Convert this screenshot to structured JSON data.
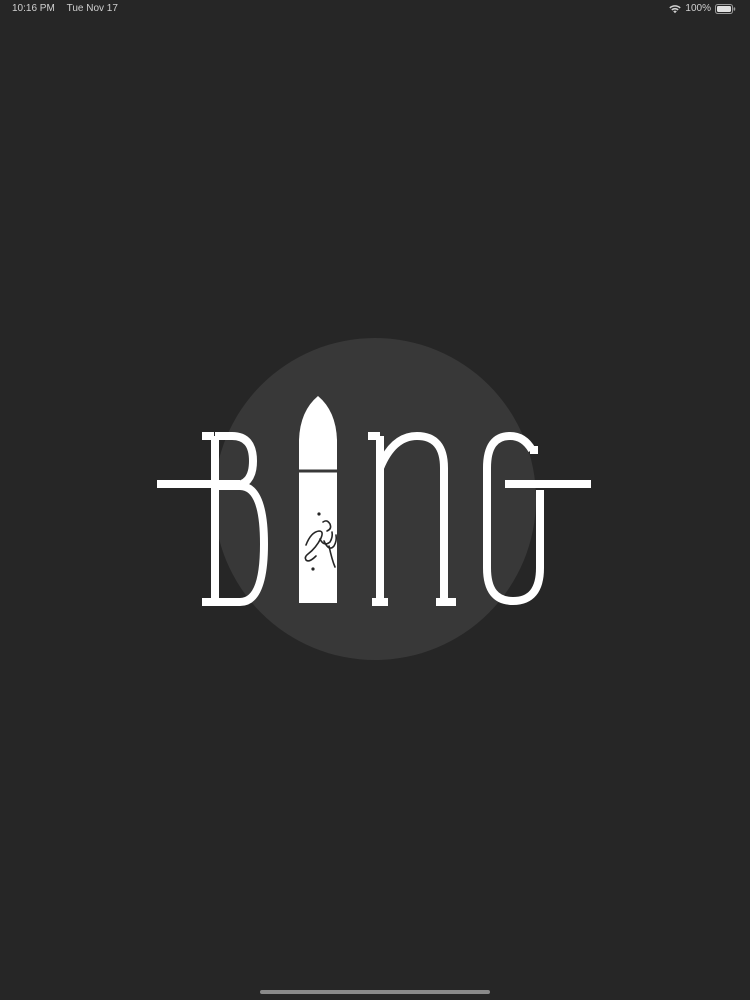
{
  "status_bar": {
    "time": "10:16 PM",
    "date": "Tue Nov 17",
    "battery_percent": "100%",
    "icons": [
      "wifi-icon",
      "battery-icon"
    ]
  },
  "splash": {
    "logo_text": "BANG",
    "logo_script": "fury",
    "background_color": "#262626",
    "circle_color": "#383838",
    "logo_color": "#ffffff"
  }
}
